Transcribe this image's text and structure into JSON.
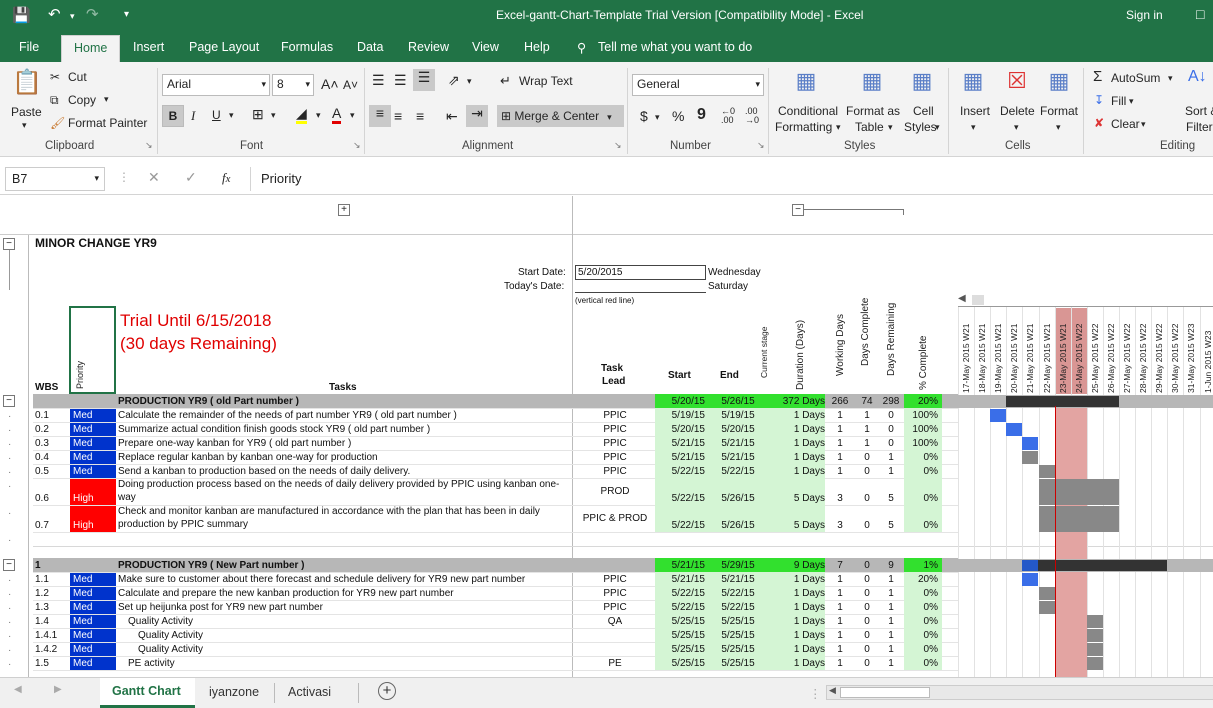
{
  "app": {
    "title": "Excel-gantt-Chart-Template Trial Version  [Compatibility Mode]  -  Excel",
    "sign_in": "Sign in"
  },
  "menu": {
    "tabs": [
      "File",
      "Home",
      "Insert",
      "Page Layout",
      "Formulas",
      "Data",
      "Review",
      "View",
      "Help"
    ],
    "tell_me": "Tell me what you want to do"
  },
  "ribbon": {
    "clipboard": {
      "paste": "Paste",
      "cut": "Cut",
      "copy": "Copy",
      "format_painter": "Format Painter",
      "label": "Clipboard"
    },
    "font": {
      "name": "Arial",
      "size": "8",
      "bold": "B",
      "italic": "I",
      "underline": "U",
      "label": "Font"
    },
    "alignment": {
      "wrap": "Wrap Text",
      "merge": "Merge & Center",
      "label": "Alignment"
    },
    "number": {
      "format": "General",
      "currency": "$",
      "percent": "%",
      "comma": "9",
      "label": "Number"
    },
    "styles": {
      "cond": [
        "Conditional",
        "Formatting"
      ],
      "table": [
        "Format as",
        "Table"
      ],
      "cell": [
        "Cell",
        "Styles"
      ],
      "label": "Styles"
    },
    "cells": {
      "insert": "Insert",
      "delete": "Delete",
      "format": "Format",
      "label": "Cells"
    },
    "editing": {
      "autosum": "AutoSum",
      "fill": "Fill",
      "clear": "Clear",
      "sort": [
        "Sort &",
        "Filter"
      ],
      "label": "Editing"
    }
  },
  "formula": {
    "name_box": "B7",
    "content": "Priority"
  },
  "sheet": {
    "title": "MINOR CHANGE YR9",
    "start_label": "Start Date:",
    "start_value": "5/20/2015",
    "start_day": "Wednesday",
    "today_label": "Today's Date:",
    "today_day": "Saturday",
    "note": "(vertical red line)",
    "trial": [
      "Trial Until 6/15/2018",
      "(30 days Remaining)"
    ],
    "headers": {
      "wbs": "WBS",
      "priority": "Priority",
      "tasks": "Tasks",
      "lead": [
        "Task",
        "Lead"
      ],
      "start": "Start",
      "end": "End",
      "stage": "Current stage",
      "duration": "Duration (Days)",
      "working": "Working Days",
      "complete_days": "Days Complete",
      "remaining": "Days Remaining",
      "pct": "% Complete"
    },
    "dates": [
      "17-May 2015  W21",
      "18-May 2015  W21",
      "19-May 2015  W21",
      "20-May 2015  W21",
      "21-May 2015  W21",
      "22-May 2015  W21",
      "23-May 2015  W21",
      "24-May 2015  W22",
      "25-May 2015  W22",
      "26-May 2015  W22",
      "27-May 2015  W22",
      "28-May 2015  W22",
      "29-May 2015  W22",
      "30-May 2015  W22",
      "31-May 2015  W23",
      "1-Jun 2015  W23"
    ],
    "rows": [
      {
        "wbs": "",
        "pri": "",
        "task": "PRODUCTION YR9 ( old Part number )",
        "lead": "",
        "start": "5/20/15",
        "end": "5/26/15",
        "dur": "372 Days",
        "work": "266",
        "done": "74",
        "rem": "298",
        "pct": "20%",
        "summary": true,
        "g0": 3,
        "g1": 10
      },
      {
        "wbs": "0.1",
        "pri": "Med",
        "task": "Calculate the remainder of the needs of part number YR9 ( old part number )",
        "lead": "PPIC",
        "start": "5/19/15",
        "end": "5/19/15",
        "dur": "1 Days",
        "work": "1",
        "done": "1",
        "rem": "0",
        "pct": "100%",
        "g0": 2,
        "g1": 3,
        "gc": "#3a6ee8"
      },
      {
        "wbs": "0.2",
        "pri": "Med",
        "task": "Summarize actual condition finish goods stock YR9 ( old part number )",
        "lead": "PPIC",
        "start": "5/20/15",
        "end": "5/20/15",
        "dur": "1 Days",
        "work": "1",
        "done": "1",
        "rem": "0",
        "pct": "100%",
        "g0": 3,
        "g1": 4,
        "gc": "#3a6ee8"
      },
      {
        "wbs": "0.3",
        "pri": "Med",
        "task": "Prepare one-way kanban for YR9 ( old part number )",
        "lead": "PPIC",
        "start": "5/21/15",
        "end": "5/21/15",
        "dur": "1 Days",
        "work": "1",
        "done": "1",
        "rem": "0",
        "pct": "100%",
        "g0": 4,
        "g1": 5,
        "gc": "#3a6ee8"
      },
      {
        "wbs": "0.4",
        "pri": "Med",
        "task": "Replace regular kanban by kanban one-way for production",
        "lead": "PPIC",
        "start": "5/21/15",
        "end": "5/21/15",
        "dur": "1 Days",
        "work": "1",
        "done": "0",
        "rem": "1",
        "pct": "0%",
        "g0": 4,
        "g1": 5,
        "gc": "#888"
      },
      {
        "wbs": "0.5",
        "pri": "Med",
        "task": "Send a kanban to production based on the needs of daily delivery.",
        "lead": "PPIC",
        "start": "5/22/15",
        "end": "5/22/15",
        "dur": "1 Days",
        "work": "1",
        "done": "0",
        "rem": "1",
        "pct": "0%",
        "g0": 5,
        "g1": 6,
        "gc": "#888"
      },
      {
        "wbs": "0.6",
        "pri": "High",
        "task": [
          "Doing production process based on the needs of daily delivery provided by PPIC using kanban one-",
          "way"
        ],
        "lead": "PROD",
        "start": "5/22/15",
        "end": "5/26/15",
        "dur": "5 Days",
        "work": "3",
        "done": "0",
        "rem": "5",
        "pct": "0%",
        "tall": true,
        "g0": 5,
        "g1": 10,
        "gc": "#888"
      },
      {
        "wbs": "0.7",
        "pri": "High",
        "task": [
          "Check and monitor kanban are manufactured in accordance with the plan that has been in daily",
          "production by PPIC summary"
        ],
        "lead": "PPIC & PROD",
        "start": "5/22/15",
        "end": "5/26/15",
        "dur": "5 Days",
        "work": "3",
        "done": "0",
        "rem": "5",
        "pct": "0%",
        "tall": true,
        "g0": 5,
        "g1": 10,
        "gc": "#888"
      },
      {
        "blank": true
      },
      {
        "wbs": "1",
        "pri": "",
        "task": "PRODUCTION YR9 ( New Part number )",
        "lead": "",
        "start": "5/21/15",
        "end": "5/29/15",
        "dur": "9 Days",
        "work": "7",
        "done": "0",
        "rem": "9",
        "pct": "1%",
        "summary": true,
        "g0": 4,
        "g1": 13
      },
      {
        "wbs": "1.1",
        "pri": "Med",
        "task": "Make sure to customer about there forecast and schedule delivery for YR9 new part number",
        "lead": "PPIC",
        "start": "5/21/15",
        "end": "5/21/15",
        "dur": "1 Days",
        "work": "1",
        "done": "0",
        "rem": "1",
        "pct": "20%",
        "g0": 4,
        "g1": 5,
        "gc": "#3a6ee8"
      },
      {
        "wbs": "1.2",
        "pri": "Med",
        "task": "Calculate and prepare the new kanban production for YR9 new part number",
        "lead": "PPIC",
        "start": "5/22/15",
        "end": "5/22/15",
        "dur": "1 Days",
        "work": "1",
        "done": "0",
        "rem": "1",
        "pct": "0%",
        "g0": 5,
        "g1": 6,
        "gc": "#888"
      },
      {
        "wbs": "1.3",
        "pri": "Med",
        "task": "Set up heijunka post for YR9 new part number",
        "lead": "PPIC",
        "start": "5/22/15",
        "end": "5/22/15",
        "dur": "1 Days",
        "work": "1",
        "done": "0",
        "rem": "1",
        "pct": "0%",
        "g0": 5,
        "g1": 6,
        "gc": "#888"
      },
      {
        "wbs": "1.4",
        "pri": "Med",
        "task": "Quality Activity",
        "lead": "QA",
        "start": "5/25/15",
        "end": "5/25/15",
        "dur": "1 Days",
        "work": "1",
        "done": "0",
        "rem": "1",
        "pct": "0%",
        "indent": 1,
        "g0": 8,
        "g1": 9,
        "gc": "#888"
      },
      {
        "wbs": "1.4.1",
        "pri": "Med",
        "task": "Quality Activity",
        "lead": "",
        "start": "5/25/15",
        "end": "5/25/15",
        "dur": "1 Days",
        "work": "1",
        "done": "0",
        "rem": "1",
        "pct": "0%",
        "indent": 2,
        "g0": 8,
        "g1": 9,
        "gc": "#888"
      },
      {
        "wbs": "1.4.2",
        "pri": "Med",
        "task": "Quality Activity",
        "lead": "",
        "start": "5/25/15",
        "end": "5/25/15",
        "dur": "1 Days",
        "work": "1",
        "done": "0",
        "rem": "1",
        "pct": "0%",
        "indent": 2,
        "g0": 8,
        "g1": 9,
        "gc": "#888"
      },
      {
        "wbs": "1.5",
        "pri": "Med",
        "task": "PE activity",
        "lead": "PE",
        "start": "5/25/15",
        "end": "5/25/15",
        "dur": "1 Days",
        "work": "1",
        "done": "0",
        "rem": "1",
        "pct": "0%",
        "indent": 1,
        "g0": 8,
        "g1": 9,
        "gc": "#888"
      }
    ]
  },
  "sheets": {
    "tabs": [
      "Gantt Chart",
      "iyanzone",
      "Activasi"
    ]
  }
}
